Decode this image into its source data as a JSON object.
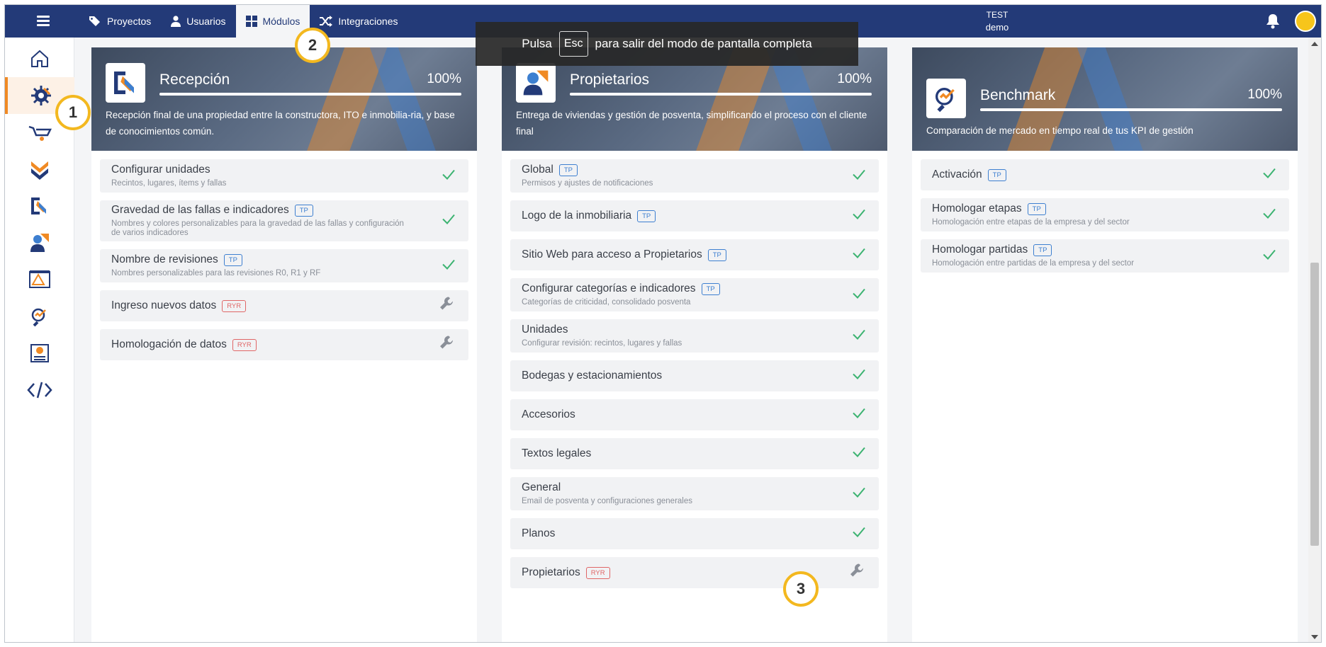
{
  "topbar": {
    "nav": [
      {
        "label": "Proyectos",
        "icon": "tags-icon"
      },
      {
        "label": "Usuarios",
        "icon": "user-icon"
      },
      {
        "label": "Módulos",
        "icon": "grid-icon",
        "active": true
      },
      {
        "label": "Integraciones",
        "icon": "shuffle-icon"
      }
    ],
    "company": "TEST",
    "user": "demo"
  },
  "toast": {
    "before": "Pulsa",
    "key": "Esc",
    "after": "para salir del modo de pantalla completa"
  },
  "sidebar": {
    "items": [
      "home-icon",
      "modules-gear-icon",
      "wheelbarrow-icon",
      "checks-icon",
      "reception-icon",
      "owners-icon",
      "blueprint-icon",
      "benchmark-icon",
      "finance-icon",
      "code-icon"
    ],
    "active_index": 1
  },
  "callouts": [
    "1",
    "2",
    "3"
  ],
  "modules": [
    {
      "title": "Recepción",
      "percent": "100%",
      "progress": 1.0,
      "description": "Recepción final de una propiedad entre la constructora, ITO e inmobilia-ria, y base de conocimientos común.",
      "items": [
        {
          "title": "Configurar unidades",
          "subtitle": "Recintos, lugares, ítems y fallas",
          "badge": "",
          "status": "check"
        },
        {
          "title": "Gravedad de las fallas e indicadores",
          "subtitle": "Nombres y colores personalizables para la gravedad de las fallas y configuración de varios indicadores",
          "badge": "TP",
          "status": "check"
        },
        {
          "title": "Nombre de revisiones",
          "subtitle": "Nombres personalizables para las revisiones R0, R1 y RF",
          "badge": "TP",
          "status": "check"
        },
        {
          "title": "Ingreso nuevos datos",
          "subtitle": "",
          "badge": "RYR",
          "status": "wrench"
        },
        {
          "title": "Homologación de datos",
          "subtitle": "",
          "badge": "RYR",
          "status": "wrench"
        }
      ]
    },
    {
      "title": "Propietarios",
      "percent": "100%",
      "progress": 1.0,
      "description": "Entrega de viviendas y gestión de posventa, simplificando el proceso con el cliente final",
      "items": [
        {
          "title": "Global",
          "subtitle": "Permisos y ajustes de notificaciones",
          "badge": "TP",
          "status": "check"
        },
        {
          "title": "Logo de la inmobiliaria",
          "subtitle": "",
          "badge": "TP",
          "status": "check"
        },
        {
          "title": "Sitio Web para acceso a Propietarios",
          "subtitle": "",
          "badge": "TP",
          "status": "check"
        },
        {
          "title": "Configurar categorías e indicadores",
          "subtitle": "Categorías de criticidad, consolidado posventa",
          "badge": "TP",
          "status": "check"
        },
        {
          "title": "Unidades",
          "subtitle": "Configurar revisión: recintos, lugares y fallas",
          "badge": "",
          "status": "check"
        },
        {
          "title": "Bodegas y estacionamientos",
          "subtitle": "",
          "badge": "",
          "status": "check"
        },
        {
          "title": "Accesorios",
          "subtitle": "",
          "badge": "",
          "status": "check"
        },
        {
          "title": "Textos legales",
          "subtitle": "",
          "badge": "",
          "status": "check"
        },
        {
          "title": "General",
          "subtitle": "Email de posventa y configuraciones generales",
          "badge": "",
          "status": "check"
        },
        {
          "title": "Planos",
          "subtitle": "",
          "badge": "",
          "status": "check"
        },
        {
          "title": "Propietarios",
          "subtitle": "",
          "badge": "RYR",
          "status": "wrench"
        }
      ]
    },
    {
      "title": "Benchmark",
      "percent": "100%",
      "progress": 1.0,
      "description": "Comparación de mercado en tiempo real de tus KPI de gestión",
      "items": [
        {
          "title": "Activación",
          "subtitle": "",
          "badge": "TP",
          "status": "check"
        },
        {
          "title": "Homologar etapas",
          "subtitle": "Homologación entre etapas de la empresa y del sector",
          "badge": "TP",
          "status": "check"
        },
        {
          "title": "Homologar partidas",
          "subtitle": "Homologación entre partidas de la empresa y del sector",
          "badge": "TP",
          "status": "check"
        }
      ]
    }
  ],
  "colors": {
    "topbar": "#233a78",
    "accent": "#f08a24",
    "check": "#3cb371",
    "callout": "#f3b81f"
  }
}
